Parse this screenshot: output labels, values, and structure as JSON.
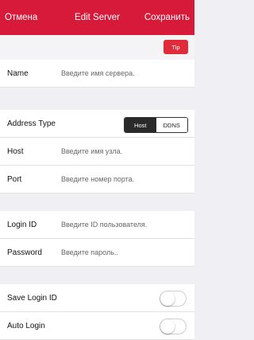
{
  "header": {
    "cancel": "Отмена",
    "title": "Edit Server",
    "save": "Сохранить",
    "accent": "#d7193a"
  },
  "tip": {
    "label": "Tip"
  },
  "name": {
    "label": "Name",
    "placeholder": "Введите имя сервера."
  },
  "address_type": {
    "label": "Address Type",
    "options": [
      "Host",
      "DDNS"
    ],
    "selected": "Host"
  },
  "host": {
    "label": "Host",
    "placeholder": "Введите имя узла."
  },
  "port": {
    "label": "Port",
    "placeholder": "Введите номер порта."
  },
  "login_id": {
    "label": "Login ID",
    "placeholder": "Введите ID пользователя."
  },
  "password": {
    "label": "Password",
    "placeholder": "Введите пароль.."
  },
  "save_login_id": {
    "label": "Save Login ID",
    "enabled": false
  },
  "auto_login": {
    "label": "Auto Login",
    "enabled": false
  }
}
